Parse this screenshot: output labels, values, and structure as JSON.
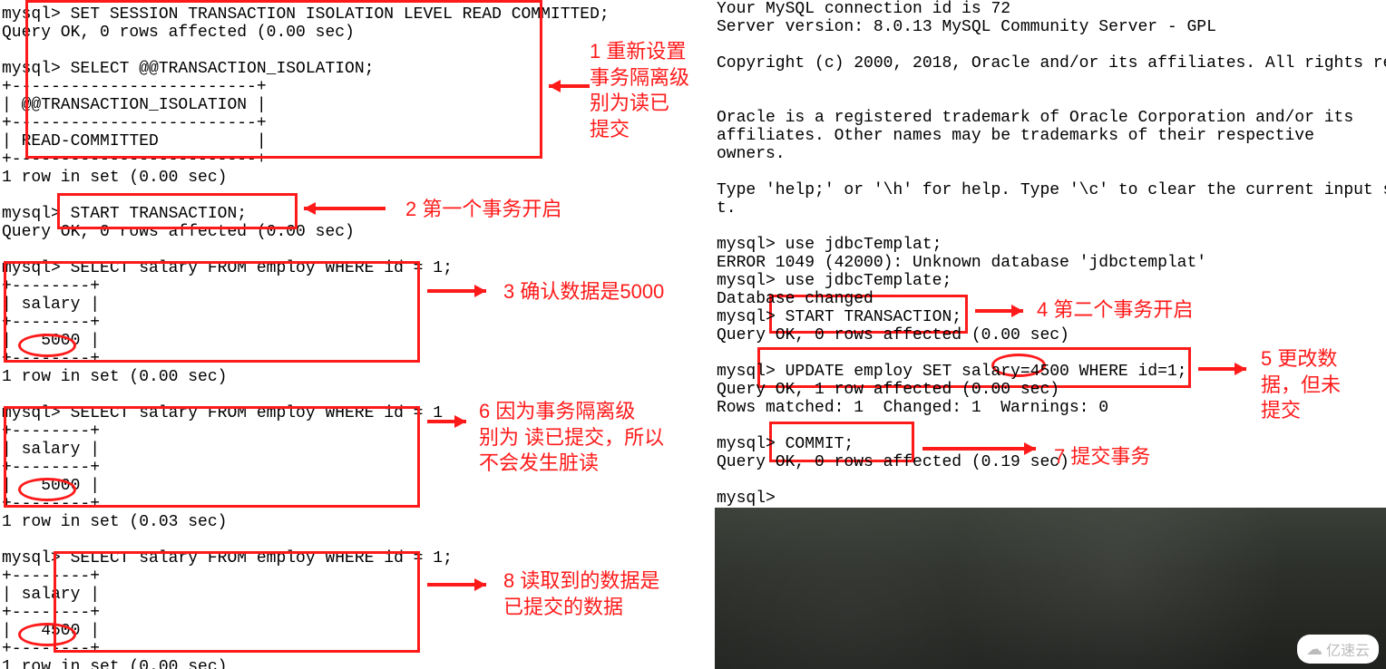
{
  "left_terminal": {
    "lines": "mysql> SET SESSION TRANSACTION ISOLATION LEVEL READ COMMITTED;\nQuery OK, 0 rows affected (0.00 sec)\n\nmysql> SELECT @@TRANSACTION_ISOLATION;\n+-------------------------+\n| @@TRANSACTION_ISOLATION |\n+-------------------------+\n| READ-COMMITTED          |\n+-------------------------+\n1 row in set (0.00 sec)\n\nmysql> START TRANSACTION;\nQuery OK, 0 rows affected (0.00 sec)\n\nmysql> SELECT salary FROM employ WHERE id = 1;\n+--------+\n| salary |\n+--------+\n|   5000 |\n+--------+\n1 row in set (0.00 sec)\n\nmysql> SELECT salary FROM employ WHERE id = 1\n+--------+\n| salary |\n+--------+\n|   5000 |\n+--------+\n1 row in set (0.03 sec)\n\nmysql> SELECT salary FROM employ WHERE id = 1;\n+--------+\n| salary |\n+--------+\n|   4500 |\n+--------+\n1 row in set (0.00 sec)"
  },
  "right_terminal": {
    "lines": "Your MySQL connection id is 72\nServer version: 8.0.13 MySQL Community Server - GPL\n\nCopyright (c) 2000, 2018, Oracle and/or its affiliates. All rights reserv\n\n\nOracle is a registered trademark of Oracle Corporation and/or its\naffiliates. Other names may be trademarks of their respective\nowners.\n\nType 'help;' or '\\h' for help. Type '\\c' to clear the current input state\nt.\n\nmysql> use jdbcTemplat;\nERROR 1049 (42000): Unknown database 'jdbctemplat'\nmysql> use jdbcTemplate;\nDatabase changed\nmysql> START TRANSACTION;\nQuery OK, 0 rows affected (0.00 sec)\n\nmysql> UPDATE employ SET salary=4500 WHERE id=1;\nQuery OK, 1 row affected (0.00 sec)\nRows matched: 1  Changed: 1  Warnings: 0\n\nmysql> COMMIT;\nQuery OK, 0 rows affected (0.19 sec)\n\nmysql>"
  },
  "annotations": {
    "a1": "1 重新设置\n事务隔离级\n别为读已\n提交",
    "a2": "2 第一个事务开启",
    "a3": "3 确认数据是5000",
    "a4": "4 第二个事务开启",
    "a5": "5 更改数\n据，但未\n提交",
    "a6": "6 因为事务隔离级\n别为 读已提交，所以\n不会发生脏读",
    "a7": "7 提交事务",
    "a8": "8 读取到的数据是\n已提交的数据"
  },
  "watermark": "亿速云",
  "colors": {
    "anno": "#ff1a1a"
  }
}
